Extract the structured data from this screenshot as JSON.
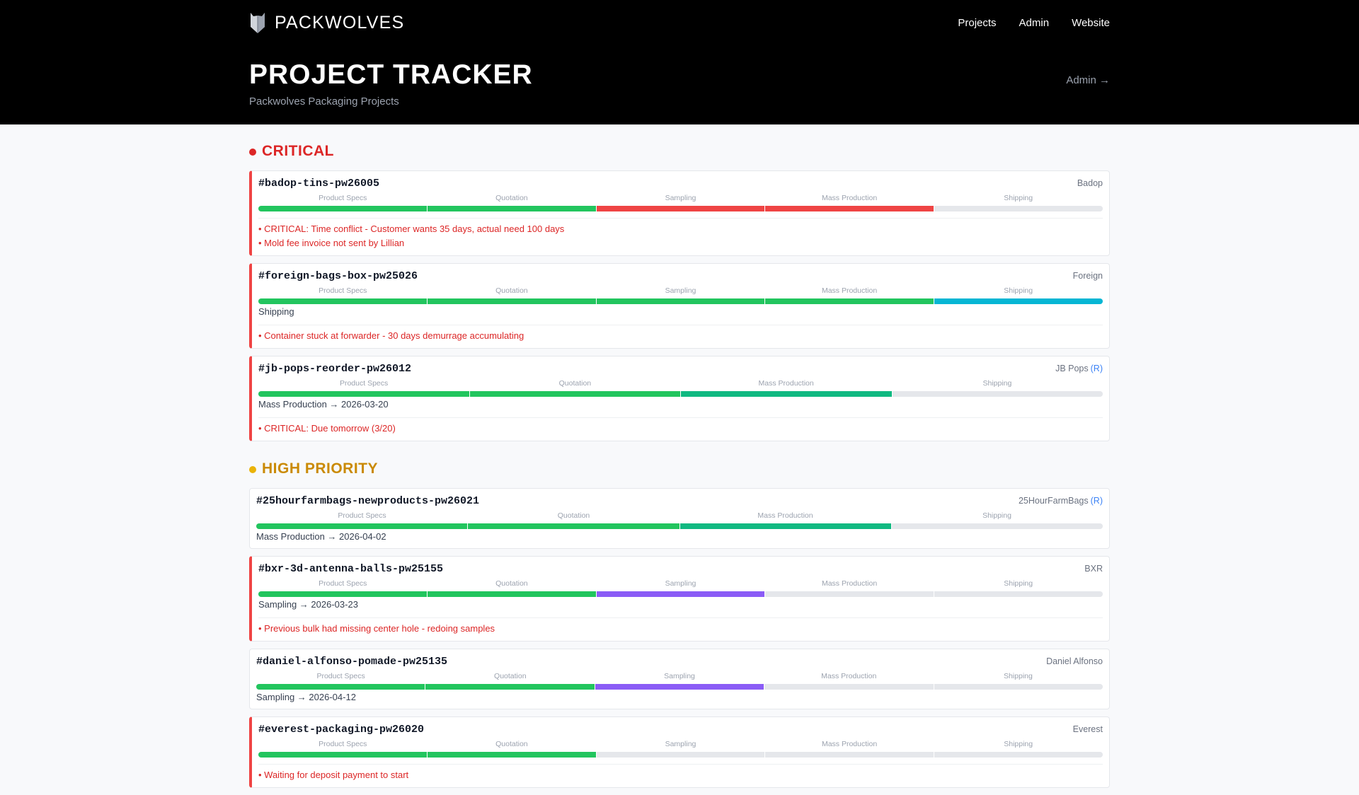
{
  "brand": "PACKWOLVES",
  "nav": [
    "Projects",
    "Admin",
    "Website"
  ],
  "title": "PROJECT TRACKER",
  "subtitle": "Packwolves Packaging Projects",
  "admin_link": "Admin →",
  "colors": {
    "done": "#22c55e",
    "critical": "#ef4444",
    "shipping": "#06b6d4",
    "production": "#10b981",
    "sampling": "#8b5cf6",
    "pending": "#e5e7eb"
  },
  "sections": [
    {
      "title": "CRITICAL",
      "color": "#dc2626",
      "dot": "#dc2626",
      "projects": [
        {
          "id": "#badop-tins-pw26005",
          "client": "Badop",
          "flag": true,
          "stages": [
            [
              "Product Specs",
              "done"
            ],
            [
              "Quotation",
              "done"
            ],
            [
              "Sampling",
              "critical"
            ],
            [
              "Mass Production",
              "critical"
            ],
            [
              "Shipping",
              "pending"
            ]
          ],
          "notes": [
            "• CRITICAL: Time conflict - Customer wants 35 days, actual need 100 days",
            "• Mold fee invoice not sent by Lillian"
          ]
        },
        {
          "id": "#foreign-bags-box-pw25026",
          "client": "Foreign",
          "flag": true,
          "stages": [
            [
              "Product Specs",
              "done"
            ],
            [
              "Quotation",
              "done"
            ],
            [
              "Sampling",
              "done"
            ],
            [
              "Mass Production",
              "done"
            ],
            [
              "Shipping",
              "shipping"
            ]
          ],
          "status": "Shipping",
          "notes": [
            "• Container stuck at forwarder - 30 days demurrage accumulating"
          ]
        },
        {
          "id": "#jb-pops-reorder-pw26012",
          "client": "JB Pops",
          "repeat": "(R)",
          "flag": true,
          "stages": [
            [
              "Product Specs",
              "done"
            ],
            [
              "Quotation",
              "done"
            ],
            [
              "Mass Production",
              "production"
            ],
            [
              "Shipping",
              "pending"
            ]
          ],
          "status": "Mass Production → 2026-03-20",
          "notes": [
            "• CRITICAL: Due tomorrow (3/20)"
          ]
        }
      ]
    },
    {
      "title": "HIGH PRIORITY",
      "color": "#ca8a04",
      "dot": "#eab308",
      "projects": [
        {
          "id": "#25hourfarmbags-newproducts-pw26021",
          "client": "25HourFarmBags",
          "repeat": "(R)",
          "flag": false,
          "stages": [
            [
              "Product Specs",
              "done"
            ],
            [
              "Quotation",
              "done"
            ],
            [
              "Mass Production",
              "production"
            ],
            [
              "Shipping",
              "pending"
            ]
          ],
          "status": "Mass Production → 2026-04-02"
        },
        {
          "id": "#bxr-3d-antenna-balls-pw25155",
          "client": "BXR",
          "flag": true,
          "stages": [
            [
              "Product Specs",
              "done"
            ],
            [
              "Quotation",
              "done"
            ],
            [
              "Sampling",
              "sampling"
            ],
            [
              "Mass Production",
              "pending"
            ],
            [
              "Shipping",
              "pending"
            ]
          ],
          "status": "Sampling → 2026-03-23",
          "notes": [
            "• Previous bulk had missing center hole - redoing samples"
          ]
        },
        {
          "id": "#daniel-alfonso-pomade-pw25135",
          "client": "Daniel Alfonso",
          "flag": false,
          "stages": [
            [
              "Product Specs",
              "done"
            ],
            [
              "Quotation",
              "done"
            ],
            [
              "Sampling",
              "sampling"
            ],
            [
              "Mass Production",
              "pending"
            ],
            [
              "Shipping",
              "pending"
            ]
          ],
          "status": "Sampling → 2026-04-12"
        },
        {
          "id": "#everest-packaging-pw26020",
          "client": "Everest",
          "flag": true,
          "stages": [
            [
              "Product Specs",
              "done"
            ],
            [
              "Quotation",
              "done"
            ],
            [
              "Sampling",
              "pending"
            ],
            [
              "Mass Production",
              "pending"
            ],
            [
              "Shipping",
              "pending"
            ]
          ],
          "notes": [
            "• Waiting for deposit payment to start"
          ]
        }
      ]
    }
  ]
}
